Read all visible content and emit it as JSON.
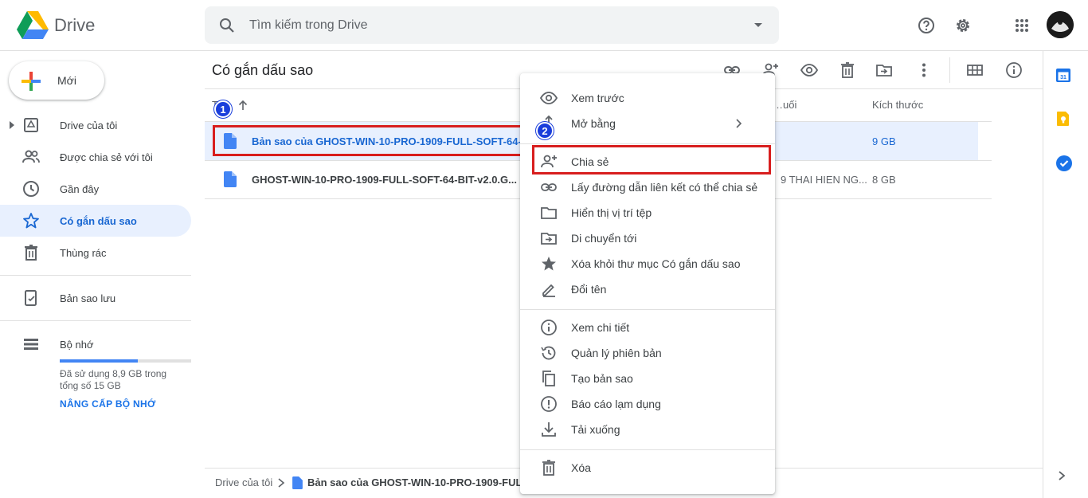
{
  "app": {
    "name": "Drive"
  },
  "search": {
    "placeholder": "Tìm kiếm trong Drive"
  },
  "header_icons": [
    "help-icon",
    "settings-icon",
    "apps-icon",
    "account-avatar"
  ],
  "sidebar": {
    "new_label": "Mới",
    "items": [
      {
        "label": "Drive của tôi",
        "icon": "my-drive-icon"
      },
      {
        "label": "Được chia sẻ với tôi",
        "icon": "shared-icon"
      },
      {
        "label": "Gần đây",
        "icon": "recent-icon"
      },
      {
        "label": "Có gắn dấu sao",
        "icon": "star-icon",
        "active": true
      },
      {
        "label": "Thùng rác",
        "icon": "trash-icon"
      },
      {
        "label": "Bản sao lưu",
        "icon": "backup-icon"
      },
      {
        "label": "Bộ nhớ",
        "icon": "storage-icon"
      }
    ],
    "storage": {
      "text": "Đã sử dụng 8,9 GB trong tổng số 15 GB",
      "used_fraction": 0.593,
      "upgrade": "NÂNG CẤP BỘ NHỚ"
    }
  },
  "main": {
    "title": "Có gắn dấu sao",
    "columns": {
      "name": "Tên",
      "modified": "…uối",
      "size": "Kích thước"
    },
    "rows": [
      {
        "name": "Bản sao của GHOST-WIN-10-PRO-1909-FULL-SOFT-64-BI...",
        "owner": "",
        "size": "9 GB",
        "selected": true
      },
      {
        "name": "GHOST-WIN-10-PRO-1909-FULL-SOFT-64-BIT-v2.0.G...",
        "owner": "9  THAI HIEN NG...",
        "size": "8 GB",
        "selected": false
      }
    ],
    "breadcrumb": {
      "root": "Drive của tôi",
      "current": "Bản sao của GHOST-WIN-10-PRO-1909-FULL..."
    }
  },
  "badges": {
    "one": "1",
    "two": "2"
  },
  "context_menu": {
    "items": [
      {
        "label": "Xem trước",
        "icon": "eye-icon"
      },
      {
        "label": "Mở bằng",
        "icon": "open-with-icon"
      },
      {
        "label": "Chia sẻ",
        "icon": "share-person-add-icon"
      },
      {
        "label": "Lấy đường dẫn liên kết có thể chia sẻ",
        "icon": "link-icon"
      },
      {
        "label": "Hiển thị vị trí tệp",
        "icon": "folder-icon"
      },
      {
        "label": "Di chuyển tới",
        "icon": "move-icon"
      },
      {
        "label": "Xóa khỏi thư mục Có gắn dấu sao",
        "icon": "star-filled-icon"
      },
      {
        "label": "Đổi tên",
        "icon": "rename-icon"
      },
      {
        "label": "Xem chi tiết",
        "icon": "info-icon"
      },
      {
        "label": "Quản lý phiên bản",
        "icon": "history-icon"
      },
      {
        "label": "Tạo bản sao",
        "icon": "copy-icon"
      },
      {
        "label": "Báo cáo lạm dụng",
        "icon": "report-icon"
      },
      {
        "label": "Tải xuống",
        "icon": "download-icon"
      },
      {
        "label": "Xóa",
        "icon": "delete-icon"
      }
    ]
  },
  "colors": {
    "accent": "#1a73e8",
    "selected_bg": "#e8f0fe",
    "highlight": "#d81e1e",
    "badge": "#1a3edb"
  }
}
